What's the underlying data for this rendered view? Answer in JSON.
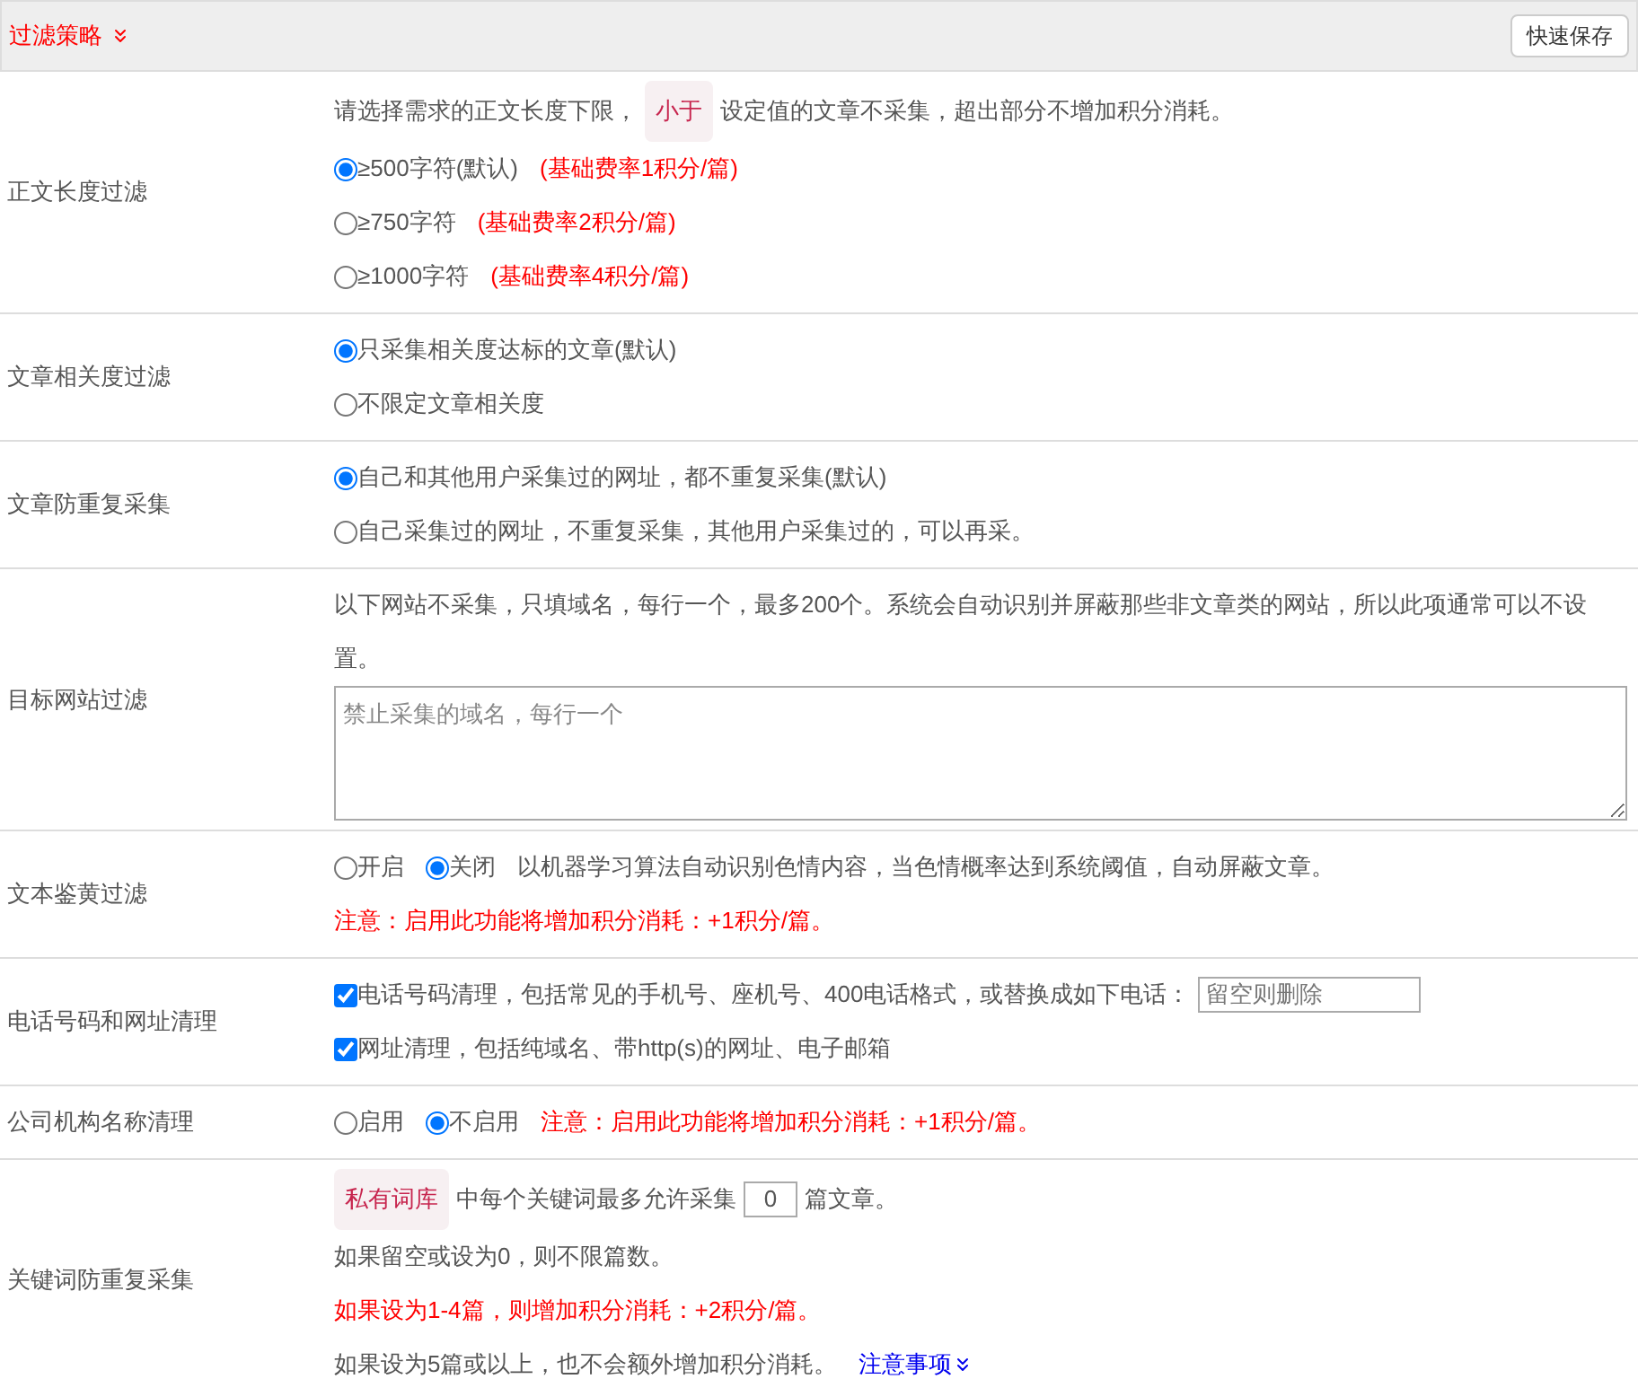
{
  "header": {
    "title": "过滤策略",
    "save_button": "快速保存"
  },
  "rows": [
    {
      "label": "正文长度过滤",
      "lines": [
        {
          "parts": [
            {
              "kind": "text",
              "text": "请选择需求的正文长度下限，"
            },
            {
              "kind": "tag",
              "text": "小于"
            },
            {
              "kind": "text",
              "text": "设定值的文章不采集，超出部分不增加积分消耗。"
            }
          ]
        },
        {
          "parts": [
            {
              "kind": "radio",
              "text": "≥500字符(默认)",
              "selected": true
            },
            {
              "kind": "warning",
              "text": "(基础费率1积分/篇)"
            }
          ]
        },
        {
          "parts": [
            {
              "kind": "radio",
              "text": "≥750字符",
              "selected": false
            },
            {
              "kind": "warning",
              "text": "(基础费率2积分/篇)"
            }
          ]
        },
        {
          "parts": [
            {
              "kind": "radio",
              "text": "≥1000字符",
              "selected": false
            },
            {
              "kind": "warning",
              "text": "(基础费率4积分/篇)"
            }
          ]
        }
      ]
    },
    {
      "label": "文章相关度过滤",
      "lines": [
        {
          "parts": [
            {
              "kind": "radio",
              "text": "只采集相关度达标的文章(默认)",
              "selected": true
            }
          ]
        },
        {
          "parts": [
            {
              "kind": "radio",
              "text": "不限定文章相关度",
              "selected": false
            }
          ]
        }
      ]
    },
    {
      "label": "文章防重复采集",
      "lines": [
        {
          "parts": [
            {
              "kind": "radio",
              "text": "自己和其他用户采集过的网址，都不重复采集(默认)",
              "selected": true
            }
          ]
        },
        {
          "parts": [
            {
              "kind": "radio",
              "text": "自己采集过的网址，不重复采集，其他用户采集过的，可以再采。",
              "selected": false
            }
          ]
        }
      ]
    },
    {
      "label": "目标网站过滤",
      "lines": [
        {
          "parts": [
            {
              "kind": "text",
              "text": "以下网站不采集，只填域名，每行一个，最多200个。系统会自动识别并屏蔽那些非文章类的网站，所以此项通常可以不设置。"
            }
          ]
        },
        {
          "parts": [
            {
              "kind": "textarea",
              "placeholder": "禁止采集的域名，每行一个"
            }
          ]
        }
      ]
    },
    {
      "label": "文本鉴黄过滤",
      "lines": [
        {
          "parts": [
            {
              "kind": "radio",
              "text": "开启",
              "selected": false
            },
            {
              "kind": "radio",
              "text": "关闭",
              "selected": true
            },
            {
              "kind": "text",
              "text": "以机器学习算法自动识别色情内容，当色情概率达到系统阈值，自动屏蔽文章。"
            }
          ]
        },
        {
          "parts": [
            {
              "kind": "warning",
              "text": "注意：启用此功能将增加积分消耗：+1积分/篇。"
            }
          ]
        }
      ]
    },
    {
      "label": "电话号码和网址清理",
      "lines": [
        {
          "parts": [
            {
              "kind": "checkbox",
              "text": "电话号码清理，包括常见的手机号、座机号、400电话格式，或替换成如下电话：",
              "checked": true
            },
            {
              "kind": "input",
              "placeholder": "留空则删除"
            }
          ]
        },
        {
          "parts": [
            {
              "kind": "checkbox",
              "text": "网址清理，包括纯域名、带http(s)的网址、电子邮箱",
              "checked": true
            }
          ]
        }
      ]
    },
    {
      "label": "公司机构名称清理",
      "lines": [
        {
          "parts": [
            {
              "kind": "radio",
              "text": "启用",
              "selected": false
            },
            {
              "kind": "radio",
              "text": "不启用",
              "selected": true
            },
            {
              "kind": "warning",
              "text": "注意：启用此功能将增加积分消耗：+1积分/篇。"
            }
          ]
        }
      ]
    },
    {
      "label": "关键词防重复采集",
      "lines": [
        {
          "parts": [
            {
              "kind": "tag",
              "text": "私有词库"
            },
            {
              "kind": "text",
              "text": "中每个关键词最多允许采集"
            },
            {
              "kind": "number",
              "value": "0"
            },
            {
              "kind": "text",
              "text": "篇文章。"
            }
          ]
        },
        {
          "parts": [
            {
              "kind": "text",
              "text": "如果留空或设为0，则不限篇数。"
            }
          ]
        },
        {
          "parts": [
            {
              "kind": "warning",
              "text": "如果设为1-4篇，则增加积分消耗：+2积分/篇。"
            }
          ]
        },
        {
          "parts": [
            {
              "kind": "text",
              "text": "如果设为5篇或以上，也不会额外增加积分消耗。"
            },
            {
              "kind": "link",
              "text": "注意事项"
            }
          ]
        }
      ]
    }
  ]
}
